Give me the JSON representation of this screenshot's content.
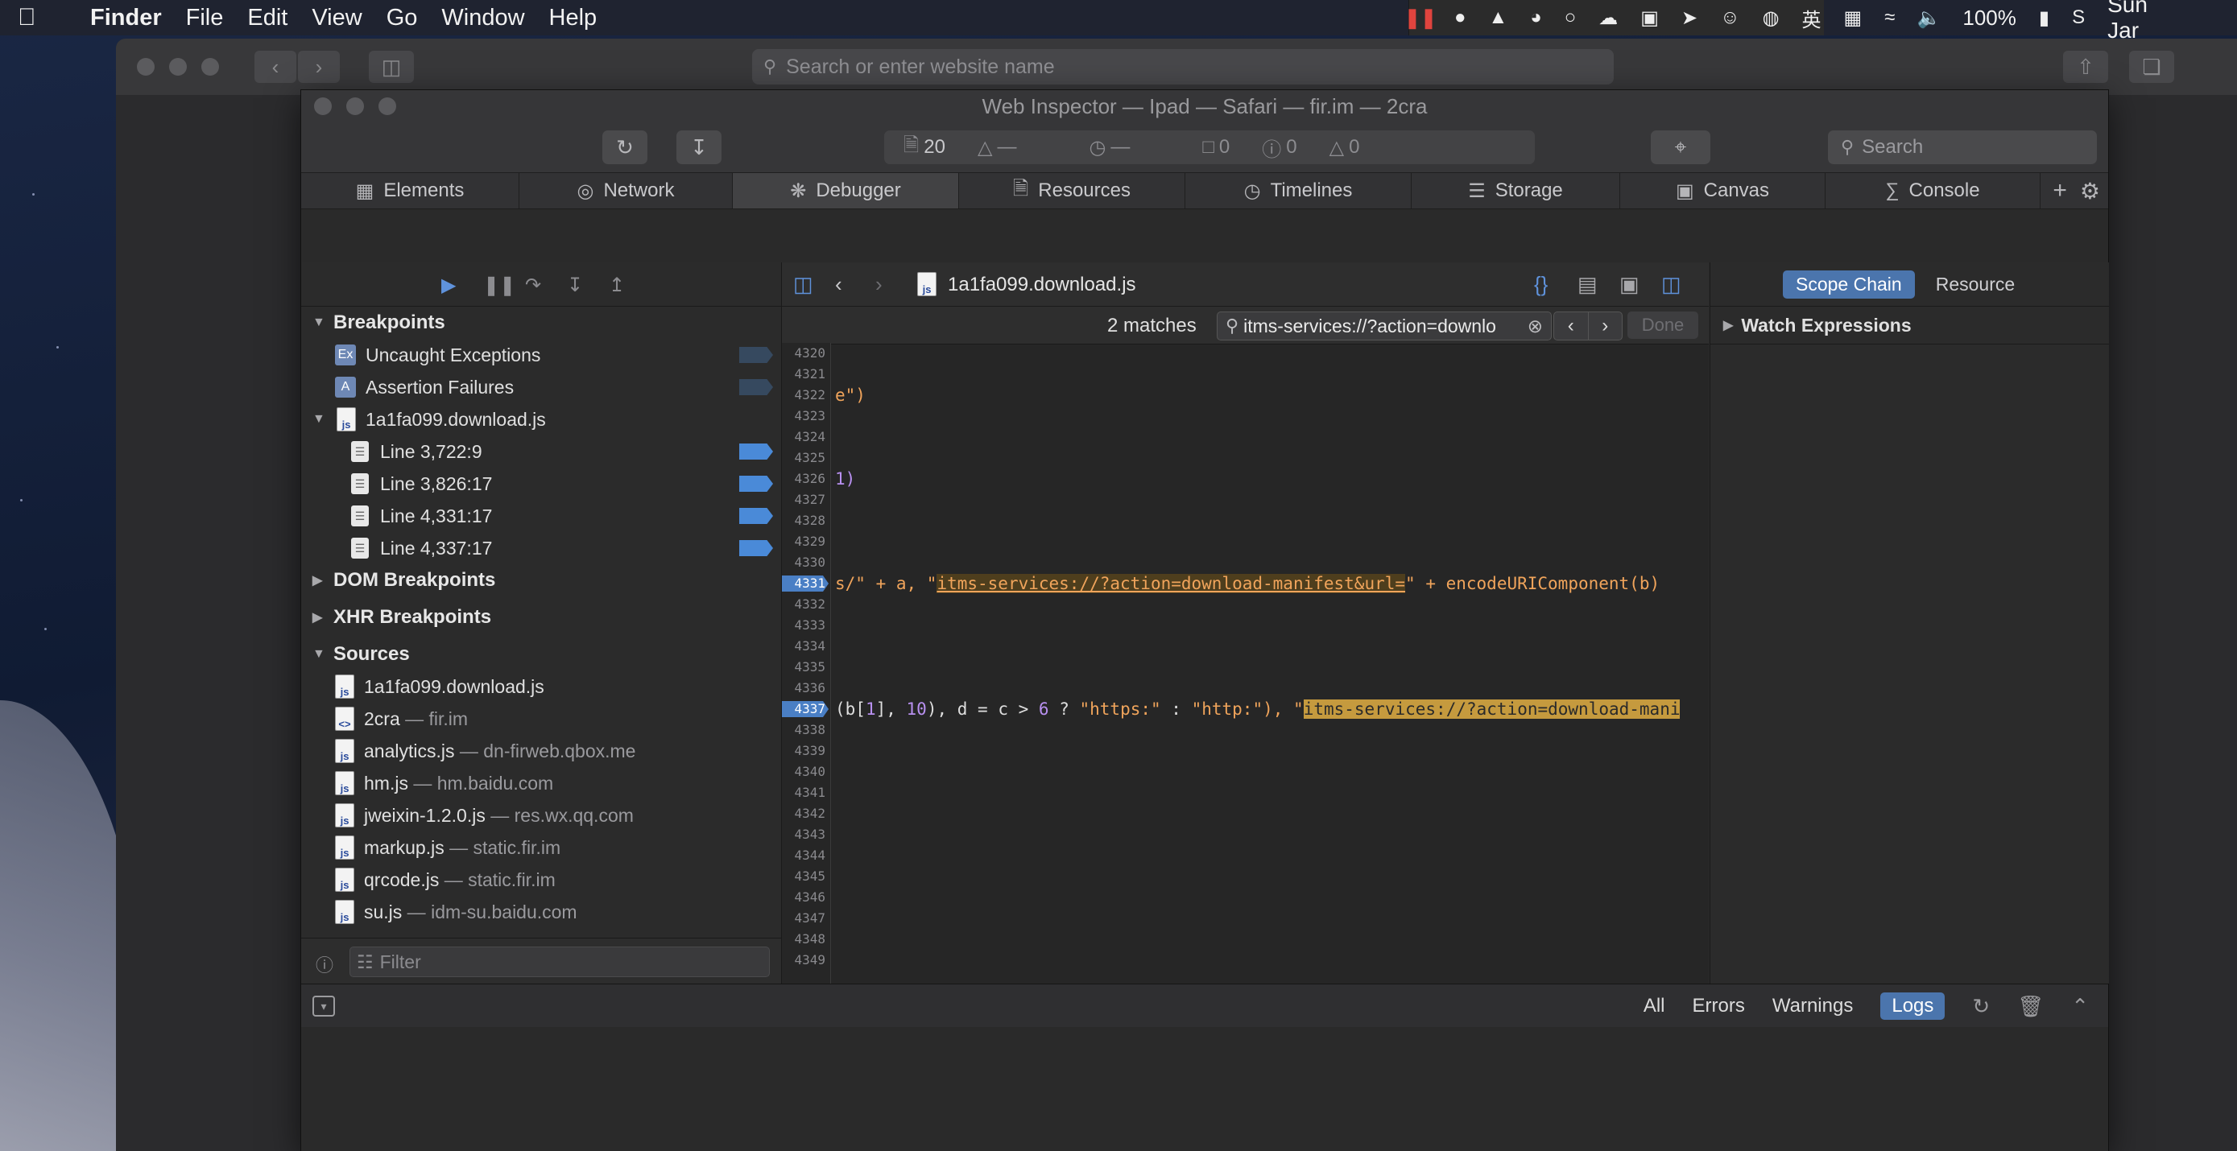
{
  "menubar": {
    "app": "Finder",
    "items": [
      "File",
      "Edit",
      "View",
      "Go",
      "Window",
      "Help"
    ],
    "input_method": "英",
    "battery": "100%",
    "clock": "Sun Jar"
  },
  "safari": {
    "address_placeholder": "Search or enter website name"
  },
  "inspector": {
    "title": "Web Inspector — Ipad — Safari — fir.im — 2cra",
    "dashboard": {
      "resources": "20",
      "size": "—",
      "time": "—",
      "logs": "0",
      "errors": "0",
      "warnings": "0"
    },
    "search_placeholder": "Search",
    "tabs": [
      {
        "label": "Elements",
        "icon": "elements-icon"
      },
      {
        "label": "Network",
        "icon": "network-icon"
      },
      {
        "label": "Debugger",
        "icon": "debugger-icon",
        "active": true
      },
      {
        "label": "Resources",
        "icon": "resources-icon"
      },
      {
        "label": "Timelines",
        "icon": "timelines-icon"
      },
      {
        "label": "Storage",
        "icon": "storage-icon"
      },
      {
        "label": "Canvas",
        "icon": "canvas-icon"
      },
      {
        "label": "Console",
        "icon": "console-icon"
      }
    ]
  },
  "sidebar": {
    "breakpoints_title": "Breakpoints",
    "uncaught": "Uncaught Exceptions",
    "assertion": "Assertion Failures",
    "file": "1a1fa099.download.js",
    "lines": [
      "Line 3,722:9",
      "Line 3,826:17",
      "Line 4,331:17",
      "Line 4,337:17"
    ],
    "dom_bp": "DOM Breakpoints",
    "xhr_bp": "XHR Breakpoints",
    "sources_title": "Sources",
    "sources": [
      {
        "name": "1a1fa099.download.js",
        "host": ""
      },
      {
        "name": "2cra",
        "host": "fir.im"
      },
      {
        "name": "analytics.js",
        "host": "dn-firweb.qbox.me"
      },
      {
        "name": "hm.js",
        "host": "hm.baidu.com"
      },
      {
        "name": "jweixin-1.2.0.js",
        "host": "res.wx.qq.com"
      },
      {
        "name": "markup.js",
        "host": "static.fir.im"
      },
      {
        "name": "qrcode.js",
        "host": "static.fir.im"
      },
      {
        "name": "su.js",
        "host": "idm-su.baidu.com"
      }
    ],
    "filter_placeholder": "Filter"
  },
  "editor": {
    "filename": "1a1fa099.download.js",
    "matches": "2 matches",
    "find_query": "itms-services://?action=downlo",
    "done": "Done",
    "line_numbers": [
      "4320",
      "4321",
      "4322",
      "4323",
      "4324",
      "4325",
      "4326",
      "4327",
      "4328",
      "4329",
      "4330",
      "4331",
      "4332",
      "4333",
      "4334",
      "4335",
      "4336",
      "4337",
      "4338",
      "4339",
      "4340",
      "4341",
      "4342",
      "4343",
      "4344",
      "4345",
      "4346",
      "4347",
      "4348",
      "4349"
    ],
    "code": {
      "l4322": "e\")",
      "l4326": "1)",
      "l4331_a": "s/\" + a, \"",
      "l4331_match": "itms-services://?action=download-manifest&url=",
      "l4331_b": "\" + encodeURIComponent(b)",
      "l4337_a": "(b[",
      "l4337_n1": "1",
      "l4337_b": "], ",
      "l4337_n2": "10",
      "l4337_c": "), d = c > ",
      "l4337_n3": "6",
      "l4337_d": " ? ",
      "l4337_s1": "\"https:\"",
      "l4337_e": " : ",
      "l4337_s2": "\"http:\"",
      "l4337_f": "), \"",
      "l4337_match": "itms-services://?action=download-mani"
    }
  },
  "details": {
    "scope_chain": "Scope Chain",
    "resource": "Resource",
    "watch": "Watch Expressions"
  },
  "console": {
    "filters": [
      "All",
      "Errors",
      "Warnings",
      "Logs"
    ],
    "active": "Logs"
  }
}
